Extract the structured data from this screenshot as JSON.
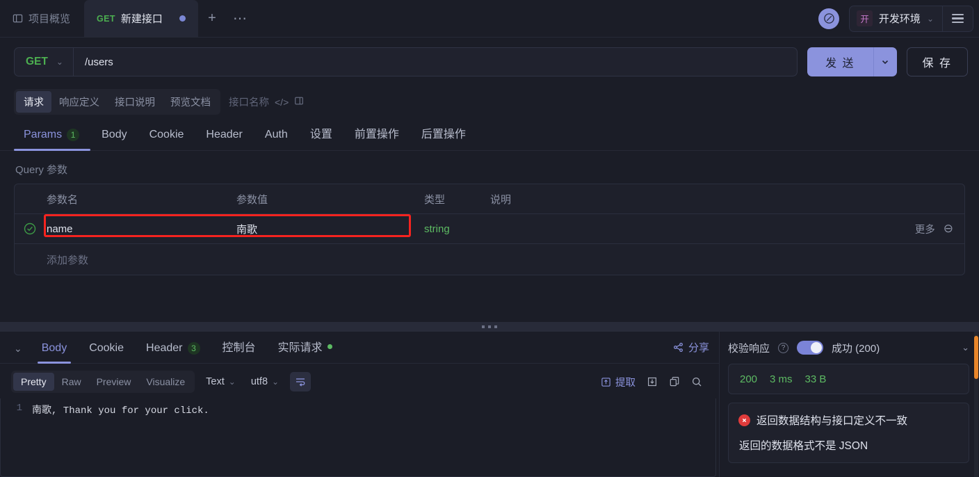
{
  "tabbar": {
    "overview_label": "项目概览",
    "active_tab": {
      "method": "GET",
      "name": "新建接口"
    },
    "add_label": "+",
    "more_label": "⋯",
    "env": {
      "badge": "开",
      "name": "开发环境"
    }
  },
  "urlbar": {
    "method": "GET",
    "path": "/users",
    "send_label": "发 送",
    "save_label": "保 存"
  },
  "docrow": {
    "tabs": [
      {
        "label": "请求",
        "active": true
      },
      {
        "label": "响应定义",
        "active": false
      },
      {
        "label": "接口说明",
        "active": false
      },
      {
        "label": "预览文档",
        "active": false
      }
    ],
    "api_name_placeholder": "接口名称",
    "code_icon_label": "</>"
  },
  "maintabs": [
    {
      "label": "Params",
      "badge": "1",
      "active": true
    },
    {
      "label": "Body",
      "badge": "",
      "active": false
    },
    {
      "label": "Cookie",
      "badge": "",
      "active": false
    },
    {
      "label": "Header",
      "badge": "",
      "active": false
    },
    {
      "label": "Auth",
      "badge": "",
      "active": false
    },
    {
      "label": "设置",
      "badge": "",
      "active": false
    },
    {
      "label": "前置操作",
      "badge": "",
      "active": false
    },
    {
      "label": "后置操作",
      "badge": "",
      "active": false
    }
  ],
  "params": {
    "section_label": "Query 参数",
    "columns": {
      "name": "参数名",
      "value": "参数值",
      "type": "类型",
      "desc": "说明"
    },
    "rows": [
      {
        "enabled": true,
        "name": "name",
        "value": "南歌",
        "type": "string",
        "desc": "",
        "more_label": "更多"
      }
    ],
    "add_placeholder": "添加参数"
  },
  "response": {
    "tabs": [
      {
        "label": "Body",
        "badge": "",
        "dot": false,
        "active": true
      },
      {
        "label": "Cookie",
        "badge": "",
        "dot": false,
        "active": false
      },
      {
        "label": "Header",
        "badge": "3",
        "dot": false,
        "active": false
      },
      {
        "label": "控制台",
        "badge": "",
        "dot": false,
        "active": false
      },
      {
        "label": "实际请求",
        "badge": "",
        "dot": true,
        "active": false
      }
    ],
    "share_label": "分享",
    "format_modes": [
      {
        "label": "Pretty",
        "active": true
      },
      {
        "label": "Raw",
        "active": false
      },
      {
        "label": "Preview",
        "active": false
      },
      {
        "label": "Visualize",
        "active": false
      }
    ],
    "type_select": "Text",
    "encoding_select": "utf8",
    "extract_label": "提取",
    "body_lines": [
      {
        "no": "1",
        "text": "南歌, Thank you for your click."
      }
    ]
  },
  "validate": {
    "title": "校验响应",
    "status": "成功 (200)",
    "stats": {
      "code": "200",
      "time": "3 ms",
      "size": "33 B"
    },
    "errors": [
      "返回数据结构与接口定义不一致",
      "返回的数据格式不是 JSON"
    ]
  },
  "colors": {
    "accent": "#8b93dd",
    "success": "#5dbb63",
    "error": "#e03b3b",
    "highlight": "#f5231f",
    "scrollbar": "#e8862a"
  }
}
